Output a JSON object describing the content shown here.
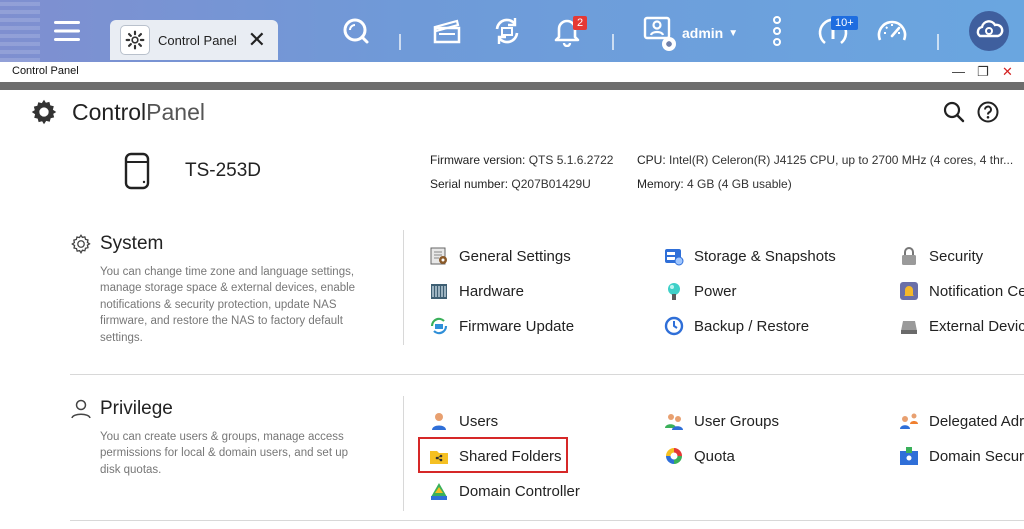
{
  "taskbar": {
    "tab_label": "Control Panel",
    "notification_count": "2",
    "user": "admin",
    "update_badge": "10+"
  },
  "window": {
    "title": "Control Panel",
    "minimize": "—",
    "restore": "❐",
    "close": "✕"
  },
  "header": {
    "title_bold": "Control",
    "title_light": "Panel"
  },
  "device": {
    "name": "TS-253D",
    "firmware_label": "Firmware version:",
    "firmware_value": "QTS 5.1.6.2722",
    "serial_label": "Serial number:",
    "serial_value": "Q207B01429U",
    "cpu_label": "CPU:",
    "cpu_value": "Intel(R) Celeron(R) J4125 CPU, up to 2700 MHz (4 cores, 4 thr...",
    "memory_label": "Memory:",
    "memory_value": "4 GB (4 GB usable)"
  },
  "system": {
    "title": "System",
    "description": "You can change time zone and language settings, manage storage space & external devices, enable notifications & security protection, update NAS firmware, and restore the NAS to factory default settings.",
    "items": [
      {
        "label": "General Settings",
        "icon": "general-settings-icon"
      },
      {
        "label": "Storage & Snapshots",
        "icon": "storage-icon"
      },
      {
        "label": "Security",
        "icon": "lock-icon"
      },
      {
        "label": "Hardware",
        "icon": "hardware-icon"
      },
      {
        "label": "Power",
        "icon": "power-icon"
      },
      {
        "label": "Notification Ce",
        "icon": "notification-icon"
      },
      {
        "label": "Firmware Update",
        "icon": "firmware-icon"
      },
      {
        "label": "Backup / Restore",
        "icon": "backup-icon"
      },
      {
        "label": "External Devic",
        "icon": "external-device-icon"
      }
    ]
  },
  "privilege": {
    "title": "Privilege",
    "description": "You can create users & groups, manage access permissions for local & domain users, and set up disk quotas.",
    "items": [
      {
        "label": "Users",
        "icon": "user-icon"
      },
      {
        "label": "User Groups",
        "icon": "user-groups-icon"
      },
      {
        "label": "Delegated Adr",
        "icon": "delegated-admin-icon"
      },
      {
        "label": "Shared Folders",
        "icon": "shared-folder-icon"
      },
      {
        "label": "Quota",
        "icon": "quota-icon"
      },
      {
        "label": "Domain Securi",
        "icon": "domain-security-icon"
      },
      {
        "label": "Domain Controller",
        "icon": "domain-controller-icon"
      }
    ]
  },
  "colors": {
    "taskbar": "#6f9ad8",
    "highlight": "#d62828",
    "badge_red": "#e53935",
    "badge_blue": "#1e6de0"
  }
}
